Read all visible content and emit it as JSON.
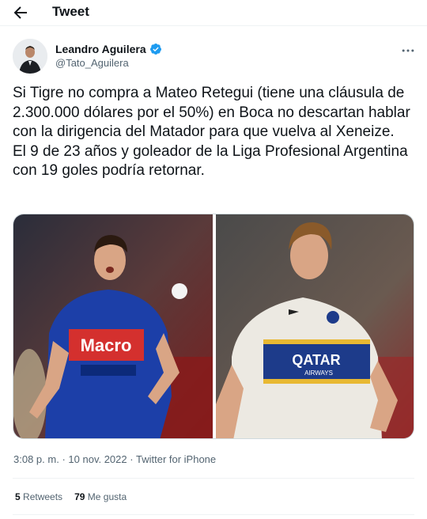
{
  "header": {
    "title": "Tweet"
  },
  "author": {
    "name": "Leandro Aguilera",
    "handle": "@Tato_Aguilera",
    "verified": true
  },
  "tweet": {
    "paragraphs": [
      "Si Tigre no compra a Mateo Retegui (tiene una cláusula de 2.300.000 dólares por el 50%) en Boca no descartan hablar con la dirigencia del Matador para que vuelva al Xeneize.",
      "El 9 de 23 años y goleador de la Liga Profesional Argentina con 19 goles podría retornar."
    ],
    "time": "3:08 p. m.",
    "date": "10 nov. 2022",
    "source": "Twitter for iPhone",
    "separator": "·"
  },
  "media": {
    "left_photo": {
      "sponsor": "Macro"
    },
    "right_photo": {
      "sponsor": "QATAR",
      "sponsor_sub": "AIRWAYS"
    }
  },
  "stats": {
    "retweets": {
      "count": "5",
      "label": "Retweets"
    },
    "likes": {
      "count": "79",
      "label": "Me gusta"
    }
  },
  "colors": {
    "verified": "#1d9bf0",
    "muted": "#536471",
    "divider": "#eff3f4"
  },
  "icons": [
    "back-arrow-icon",
    "verified-badge-icon",
    "more-options-icon"
  ]
}
